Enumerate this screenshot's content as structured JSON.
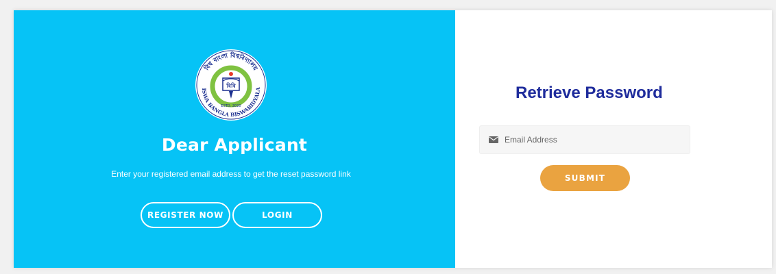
{
  "left_panel": {
    "title": "Dear Applicant",
    "subtitle": "Enter your registered email address to get the reset password link",
    "register_label": "REGISTER NOW",
    "login_label": "LOGIN",
    "logo": {
      "icon": "university-seal-logo",
      "ring_text_top": "বিশ্ব বাংলা বিশ্ববিদ্যালয়",
      "ring_text_bottom": "BISWA BANGLA BISWABIDYALAY",
      "estd": "ESTD. 2020"
    }
  },
  "right_panel": {
    "title": "Retrieve Password",
    "email_placeholder": "Email Address",
    "email_value": "",
    "email_icon": "envelope-icon",
    "submit_label": "SUBMIT"
  },
  "colors": {
    "left_bg": "#06c3f6",
    "title_blue": "#1f2c9c",
    "submit_orange": "#eaa340"
  }
}
